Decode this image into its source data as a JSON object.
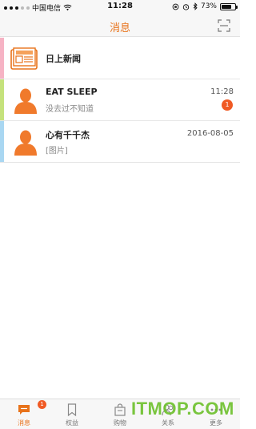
{
  "status_bar": {
    "carrier": "中国电信",
    "time": "11:28",
    "battery": "73%",
    "battery_level": 0.73
  },
  "header": {
    "title": "消息"
  },
  "messages": {
    "news": {
      "title": "日上新闻",
      "stripe_color": "#f6b3c4"
    },
    "chats": [
      {
        "name": "EAT SLEEP",
        "preview": "没去过不知道",
        "time": "11:28",
        "unread": "1",
        "stripe_color": "#c5e27c"
      },
      {
        "name": "心有千千杰",
        "preview": "[图片]",
        "time": "2016-08-05",
        "stripe_color": "#a9d7f2"
      }
    ]
  },
  "tabs": [
    {
      "label": "消息",
      "icon": "chat-bubble-icon",
      "active": true,
      "badge": "1"
    },
    {
      "label": "权益",
      "icon": "bookmark-icon",
      "active": false
    },
    {
      "label": "购物",
      "icon": "shopping-bag-icon",
      "active": false
    },
    {
      "label": "关系",
      "icon": "people-icon",
      "active": false
    },
    {
      "label": "更多",
      "icon": "more-icon",
      "active": false
    }
  ],
  "watermark": "ITMOP.COM",
  "colors": {
    "accent": "#e8731b",
    "badge": "#f05a24",
    "watermark": "#6cc02a"
  }
}
